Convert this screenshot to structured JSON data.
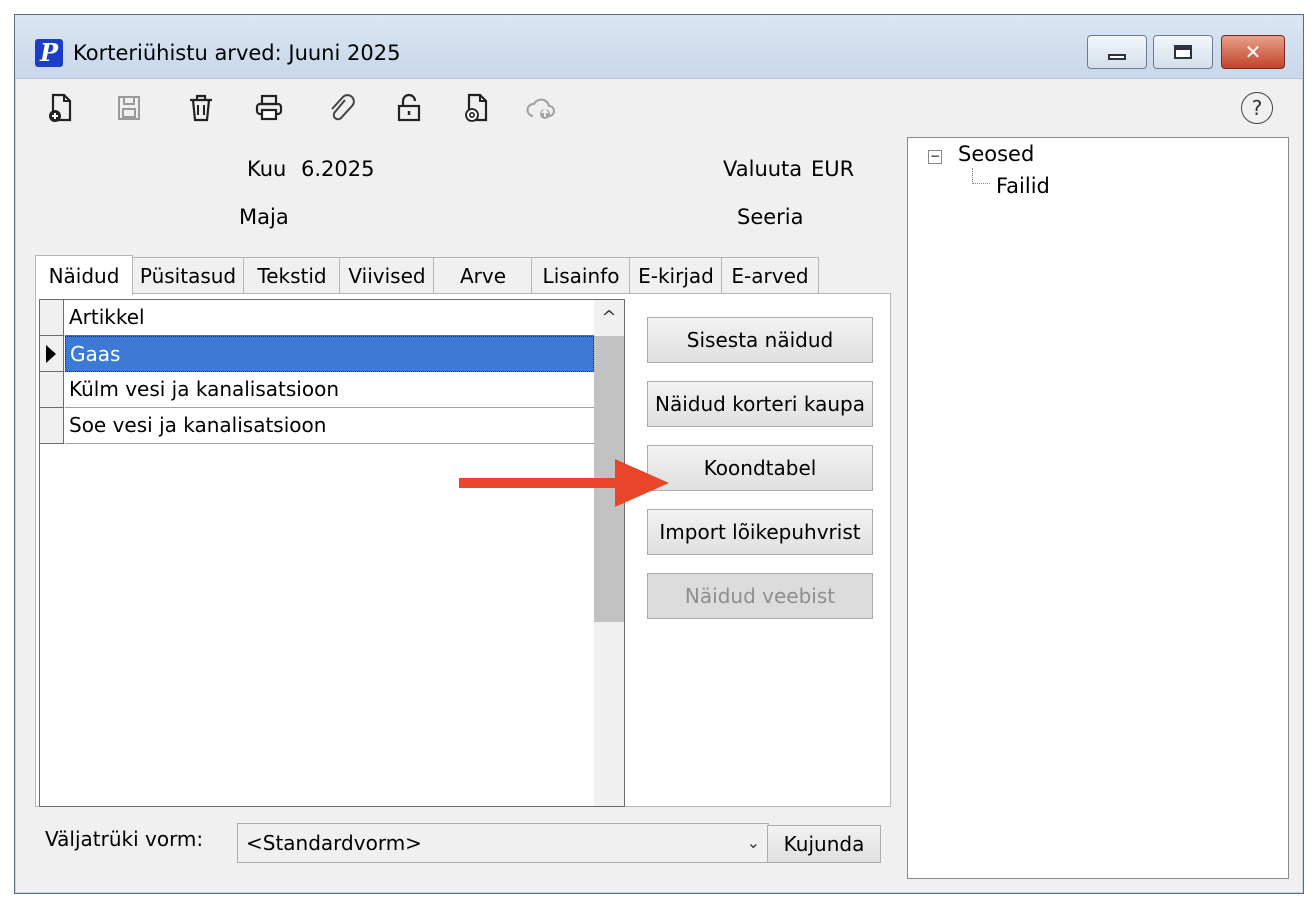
{
  "window": {
    "title": "Korteriühistu arved: Juuni 2025",
    "app_icon_letter": "P",
    "controls": {
      "minimize": "minimize",
      "maximize": "maximize",
      "close": "✕"
    }
  },
  "toolbar": {
    "icons": [
      "new-doc-icon",
      "save-icon",
      "delete-icon",
      "print-icon",
      "attach-icon",
      "unlock-icon",
      "email-doc-icon",
      "cloud-upload-icon"
    ],
    "help_label": "?"
  },
  "header_fields": {
    "kuu_label": "Kuu",
    "kuu_value": "6.2025",
    "maja_label": "Maja",
    "valuuta_label": "Valuuta",
    "valuuta_value": "EUR",
    "seeria_label": "Seeria"
  },
  "tree": {
    "root": "Seosed",
    "child": "Failid",
    "expander": "−"
  },
  "tabs": [
    "Näidud",
    "Püsitasud",
    "Tekstid",
    "Viivised",
    "Arve",
    "Lisainfo",
    "E-kirjad",
    "E-arved"
  ],
  "active_tab": "Näidud",
  "grid": {
    "column_header": "Artikkel",
    "rows": [
      "Gaas",
      "Külm vesi ja kanalisatsioon",
      "Soe vesi ja kanalisatsioon"
    ],
    "selected_row": 0,
    "scroll_up": "^"
  },
  "buttons": {
    "sisesta": "Sisesta näidud",
    "korteri": "Näidud korteri kaupa",
    "koondtabel": "Koondtabel",
    "import": "Import lõikepuhvrist",
    "veebist": "Näidud veebist"
  },
  "bottom": {
    "form_label": "Väljatrüki vorm:",
    "form_value": "<Standardvorm>",
    "kujunda": "Kujunda"
  },
  "colors": {
    "selection": "#3c7ad6",
    "annotation_arrow": "#e8452a"
  }
}
